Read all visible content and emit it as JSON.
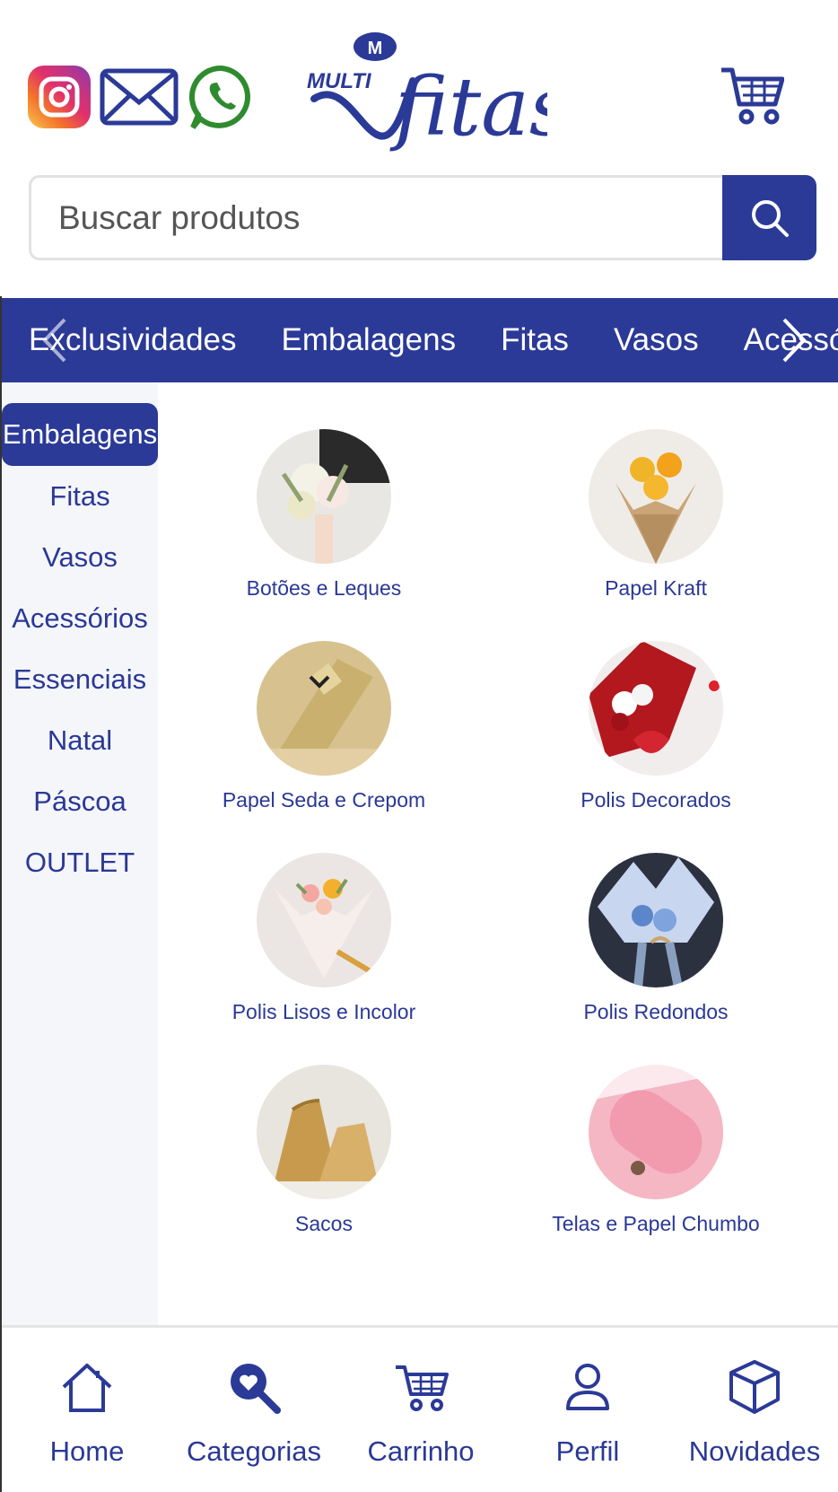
{
  "brand": {
    "logo_top": "MULTI",
    "logo_script": "fitas"
  },
  "header": {
    "social": [
      "instagram-icon",
      "mail-icon",
      "whatsapp-icon"
    ],
    "cart_icon": "cart-icon"
  },
  "search": {
    "placeholder": "Buscar produtos",
    "button_icon": "search-icon"
  },
  "top_categories": [
    "Exclusividades",
    "Embalagens",
    "Fitas",
    "Vasos",
    "Acessórios"
  ],
  "sidebar": {
    "items": [
      {
        "label": "Embalagens",
        "active": true
      },
      {
        "label": "Fitas"
      },
      {
        "label": "Vasos"
      },
      {
        "label": "Acessórios"
      },
      {
        "label": "Essenciais"
      },
      {
        "label": "Natal"
      },
      {
        "label": "Páscoa"
      },
      {
        "label": "OUTLET"
      }
    ]
  },
  "subcategories": [
    {
      "label": "Botões e Leques"
    },
    {
      "label": "Papel Kraft"
    },
    {
      "label": "Papel Seda e Crepom"
    },
    {
      "label": "Polis Decorados"
    },
    {
      "label": "Polis Lisos e Incolor"
    },
    {
      "label": "Polis Redondos"
    },
    {
      "label": "Sacos"
    },
    {
      "label": "Telas e Papel Chumbo"
    }
  ],
  "bottom_nav": [
    {
      "label": "Home",
      "icon": "home-icon"
    },
    {
      "label": "Categorias",
      "icon": "categories-search-icon"
    },
    {
      "label": "Carrinho",
      "icon": "cart-icon"
    },
    {
      "label": "Perfil",
      "icon": "user-icon"
    },
    {
      "label": "Novidades",
      "icon": "box-icon"
    }
  ],
  "colors": {
    "primary": "#2b3a97",
    "sidebar_bg": "#f5f6fa",
    "whatsapp": "#2e8b2e"
  }
}
